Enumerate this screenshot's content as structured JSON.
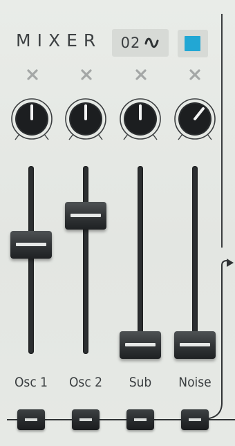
{
  "mixer": {
    "title": "MIXER",
    "wave_select": {
      "value": "02",
      "icon": "sine-wave-icon"
    },
    "color_button": {
      "color": "#22a7d4"
    },
    "channels": [
      {
        "id": "osc1",
        "label": "Osc 1",
        "knob_value": 0.5,
        "fader_value": 0.55,
        "mute_icon": "x-icon"
      },
      {
        "id": "osc2",
        "label": "Osc 2",
        "knob_value": 0.5,
        "fader_value": 0.8,
        "mute_icon": "x-icon"
      },
      {
        "id": "sub",
        "label": "Sub",
        "knob_value": 0.5,
        "fader_value": 0.0,
        "mute_icon": "x-icon"
      },
      {
        "id": "noise",
        "label": "Noise",
        "knob_value": 0.72,
        "fader_value": 0.0,
        "mute_icon": "x-icon"
      }
    ]
  },
  "colors": {
    "accent": "#22a7d4",
    "panel": "#e5e8e4",
    "dark": "#2c2f31",
    "text": "#3b3f41",
    "mute_x": "#a4a7a6"
  }
}
